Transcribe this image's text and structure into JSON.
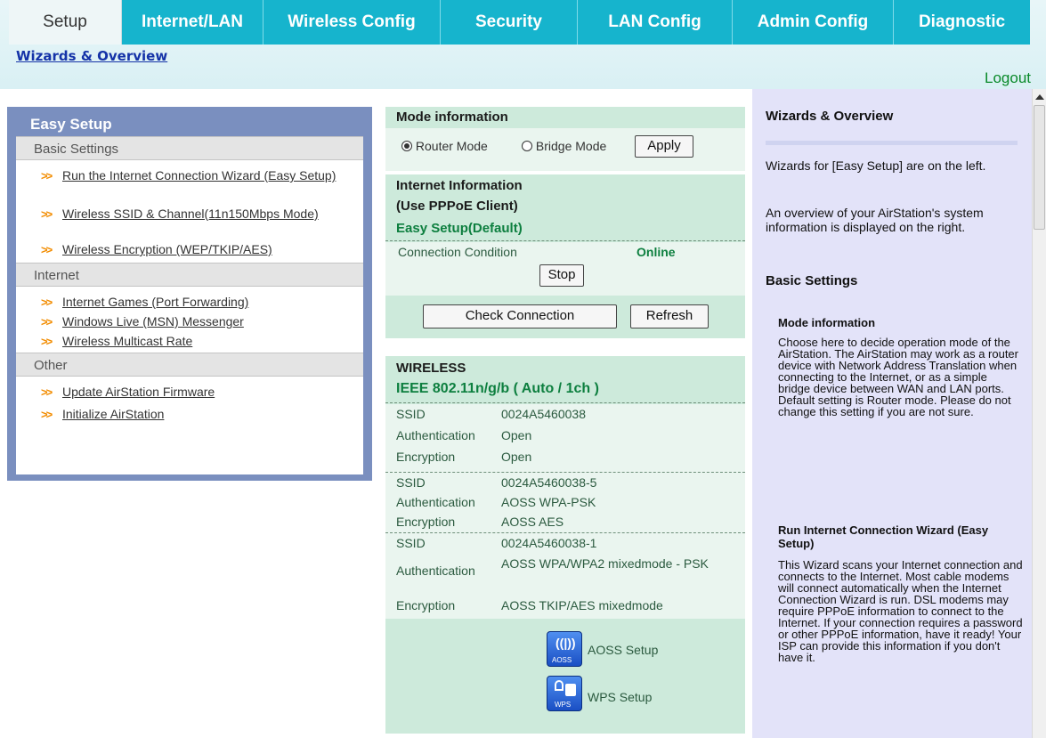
{
  "nav": {
    "tabs": [
      "Setup",
      "Internet/LAN",
      "Wireless Config",
      "Security",
      "LAN Config",
      "Admin Config",
      "Diagnostic"
    ],
    "subnav": "Wizards & Overview",
    "logout": "Logout"
  },
  "easy_setup": {
    "title": "Easy Setup",
    "sections": [
      {
        "heading": "Basic Settings",
        "items": [
          "Run the Internet Connection Wizard (Easy Setup)",
          "Wireless SSID & Channel(11n150Mbps Mode)",
          "Wireless Encryption (WEP/TKIP/AES)"
        ]
      },
      {
        "heading": "Internet",
        "items": [
          "Internet Games (Port Forwarding)",
          "Windows Live (MSN) Messenger",
          "Wireless Multicast Rate"
        ]
      },
      {
        "heading": "Other",
        "items": [
          "Update AirStation Firmware",
          "Initialize AirStation"
        ]
      }
    ]
  },
  "mode": {
    "title": "Mode information",
    "router_label": "Router Mode",
    "bridge_label": "Bridge Mode",
    "selected": "Router Mode",
    "apply": "Apply"
  },
  "internet": {
    "title1": "Internet Information",
    "title2": "(Use PPPoE Client)",
    "profile": "Easy Setup(Default)",
    "condition_label": "Connection Condition",
    "condition_value": "Online",
    "stop": "Stop",
    "check": "Check Connection",
    "refresh": "Refresh"
  },
  "wireless": {
    "title": "WIRELESS",
    "standard": "IEEE 802.11n/g/b ( Auto / 1ch )",
    "groups": [
      {
        "ssid": "0024A5460038",
        "auth": "Open",
        "enc": "Open"
      },
      {
        "ssid": "0024A5460038-5",
        "auth": "AOSS WPA-PSK",
        "enc": "AOSS AES"
      },
      {
        "ssid": "0024A5460038-1",
        "auth": "AOSS WPA/WPA2 mixedmode - PSK",
        "enc": "AOSS TKIP/AES mixedmode"
      }
    ],
    "labels": {
      "ssid": "SSID",
      "auth": "Authentication",
      "enc": "Encryption"
    },
    "aoss_label": "AOSS Setup",
    "wps_label": "WPS Setup",
    "aoss_icon_text": "AOSS",
    "wps_icon_text": "WPS"
  },
  "help": {
    "title": "Wizards & Overview",
    "intro1": "Wizards for [Easy Setup] are on the left.",
    "intro2": "An overview of your AirStation's system information is displayed on the right.",
    "basic_heading": "Basic Settings",
    "mode_heading": "Mode information",
    "mode_text": "Choose here to decide operation mode of the AirStation. The AirStation may work as a router device with Network Address Translation when connecting to the Internet, or as a simple bridge device between WAN and LAN ports. Default setting is Router mode. Please do not change this setting if you are not sure.",
    "wizard_heading": "Run Internet Connection Wizard (Easy Setup)",
    "wizard_text": "This Wizard scans your Internet connection and connects to the Internet. Most cable modems will connect automatically when the Internet Connection Wizard is run. DSL modems may require PPPoE information to connect to the Internet. If your connection requires a password or other PPPoE information, have it ready! Your ISP can provide this information if you don't have it."
  },
  "colors": {
    "tab_bg": "#16b4cd",
    "panel_blue": "#7a8fbf",
    "band_green": "#cdeadb",
    "help_bg": "#e3e3f9",
    "bullet": "#f28c00"
  }
}
